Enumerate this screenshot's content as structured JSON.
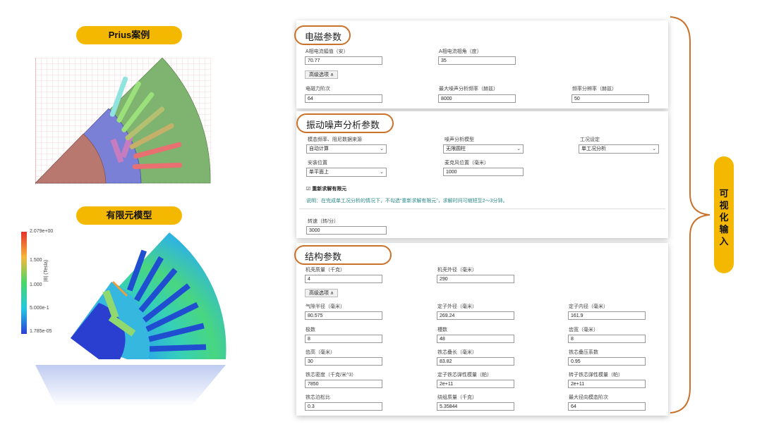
{
  "left": {
    "prius_label": "Prius案例",
    "fem_label": "有限元模型",
    "colorbar": {
      "ticks": [
        "2.079e+00",
        "1.500",
        "1.000",
        "5.000e-1",
        "1.785e-05"
      ],
      "axis_label": "|B| (Tesla)"
    }
  },
  "side_label": [
    "可",
    "视",
    "化",
    "输",
    "入"
  ],
  "em": {
    "title": "电磁参数",
    "fields": [
      {
        "label": "A相电流幅值（安）",
        "value": "70.77"
      },
      {
        "label": "A相电流相角（度）",
        "value": "35"
      }
    ],
    "advanced": "高级选项 ∧",
    "fields2": [
      {
        "label": "电磁力阶次",
        "value": "64"
      },
      {
        "label": "最大噪声分析频率（赫兹）",
        "value": "8000"
      },
      {
        "label": "频率分辨率（赫兹）",
        "value": "50"
      }
    ]
  },
  "vib": {
    "title": "振动噪声分析参数",
    "selects": [
      {
        "label": "模态频率、阻尼数据来源",
        "value": "自动计算"
      },
      {
        "label": "噪声分析模型",
        "value": "无限圆柱"
      },
      {
        "label": "工况设定",
        "value": "单工况分析"
      },
      {
        "label": "安装位置",
        "value": "单平面上"
      }
    ],
    "mic": {
      "label": "麦克风位置（毫米）",
      "value": "1000"
    },
    "recalc": "☑ 重新求解有限元",
    "note": "说明：在完成单工况分析的情况下，不勾选“重新求解有限元”，求解时间可缩短至2～3分钟。",
    "speed": {
      "label": "转速（转/分）",
      "value": "3000"
    }
  },
  "struct": {
    "title": "结构参数",
    "fields": [
      {
        "label": "机壳质量（千克）",
        "value": "4"
      },
      {
        "label": "机壳外径（毫米）",
        "value": "290"
      }
    ],
    "advanced": "高级选项 ∧",
    "grid": [
      {
        "label": "气隙半径（毫米）",
        "value": "80.575"
      },
      {
        "label": "定子外径（毫米）",
        "value": "269.24"
      },
      {
        "label": "定子内径（毫米）",
        "value": "161.9"
      },
      {
        "label": "极数",
        "value": "8"
      },
      {
        "label": "槽数",
        "value": "48"
      },
      {
        "label": "齿宽（毫米）",
        "value": "8"
      },
      {
        "label": "齿高（毫米）",
        "value": "30"
      },
      {
        "label": "铁芯叠长（毫米）",
        "value": "83.82"
      },
      {
        "label": "铁芯叠压系数",
        "value": "0.95"
      },
      {
        "label": "铁芯密度（千克/米^3）",
        "value": "7850"
      },
      {
        "label": "定子铁芯弹性模量（帕）",
        "value": "2e+11"
      },
      {
        "label": "转子铁芯弹性模量（帕）",
        "value": "2e+11"
      },
      {
        "label": "铁芯泊松比",
        "value": "0.3"
      },
      {
        "label": "绕组质量（千克）",
        "value": "5.35844"
      },
      {
        "label": "最大径向模态阶次",
        "value": "64"
      }
    ]
  },
  "colors": {
    "accent": "#f5b800",
    "oval": "#c9722b",
    "note": "#2a8a8a"
  }
}
